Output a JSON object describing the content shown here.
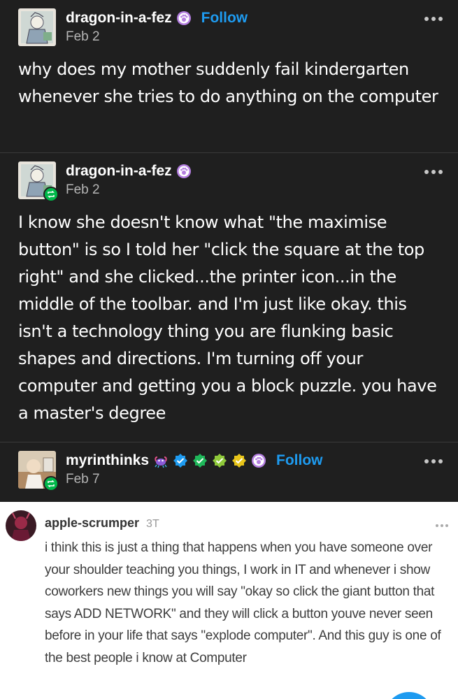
{
  "posts": [
    {
      "username": "dragon-in-a-fez",
      "follow_label": "Follow",
      "date": "Feb 2",
      "body": "why does my mother suddenly fail kindergarten whenever she tries to do anything on the computer"
    },
    {
      "username": "dragon-in-a-fez",
      "date": "Feb 2",
      "body": "I know she doesn't know what \"the maximise button\" is so I told her \"click the square at the top right\" and she clicked...the printer icon...in the middle of the toolbar. and I'm just like okay. this isn't a technology thing you are flunking basic shapes and directions. I'm turning off your computer and getting you a block puzzle. you have a master's degree"
    },
    {
      "username": "myrinthinks",
      "follow_label": "Follow",
      "date": "Feb 7"
    }
  ],
  "comment": {
    "username": "apple-scrumper",
    "time": "3T",
    "body": "i think this is just a thing that happens when you have someone over your shoulder teaching you things, I work in IT and whenever i show coworkers new things you will say \"okay so click the giant button that says ADD NETWORK\" and they will click a button youve never seen before in your life that says \"explode computer\". And this guy is one of the best people i know at Computer"
  },
  "colors": {
    "background": "#1f1f1f",
    "follow": "#1e9bf0",
    "reblog_badge": "#00b84a",
    "comment_panel": "#ffffff"
  }
}
